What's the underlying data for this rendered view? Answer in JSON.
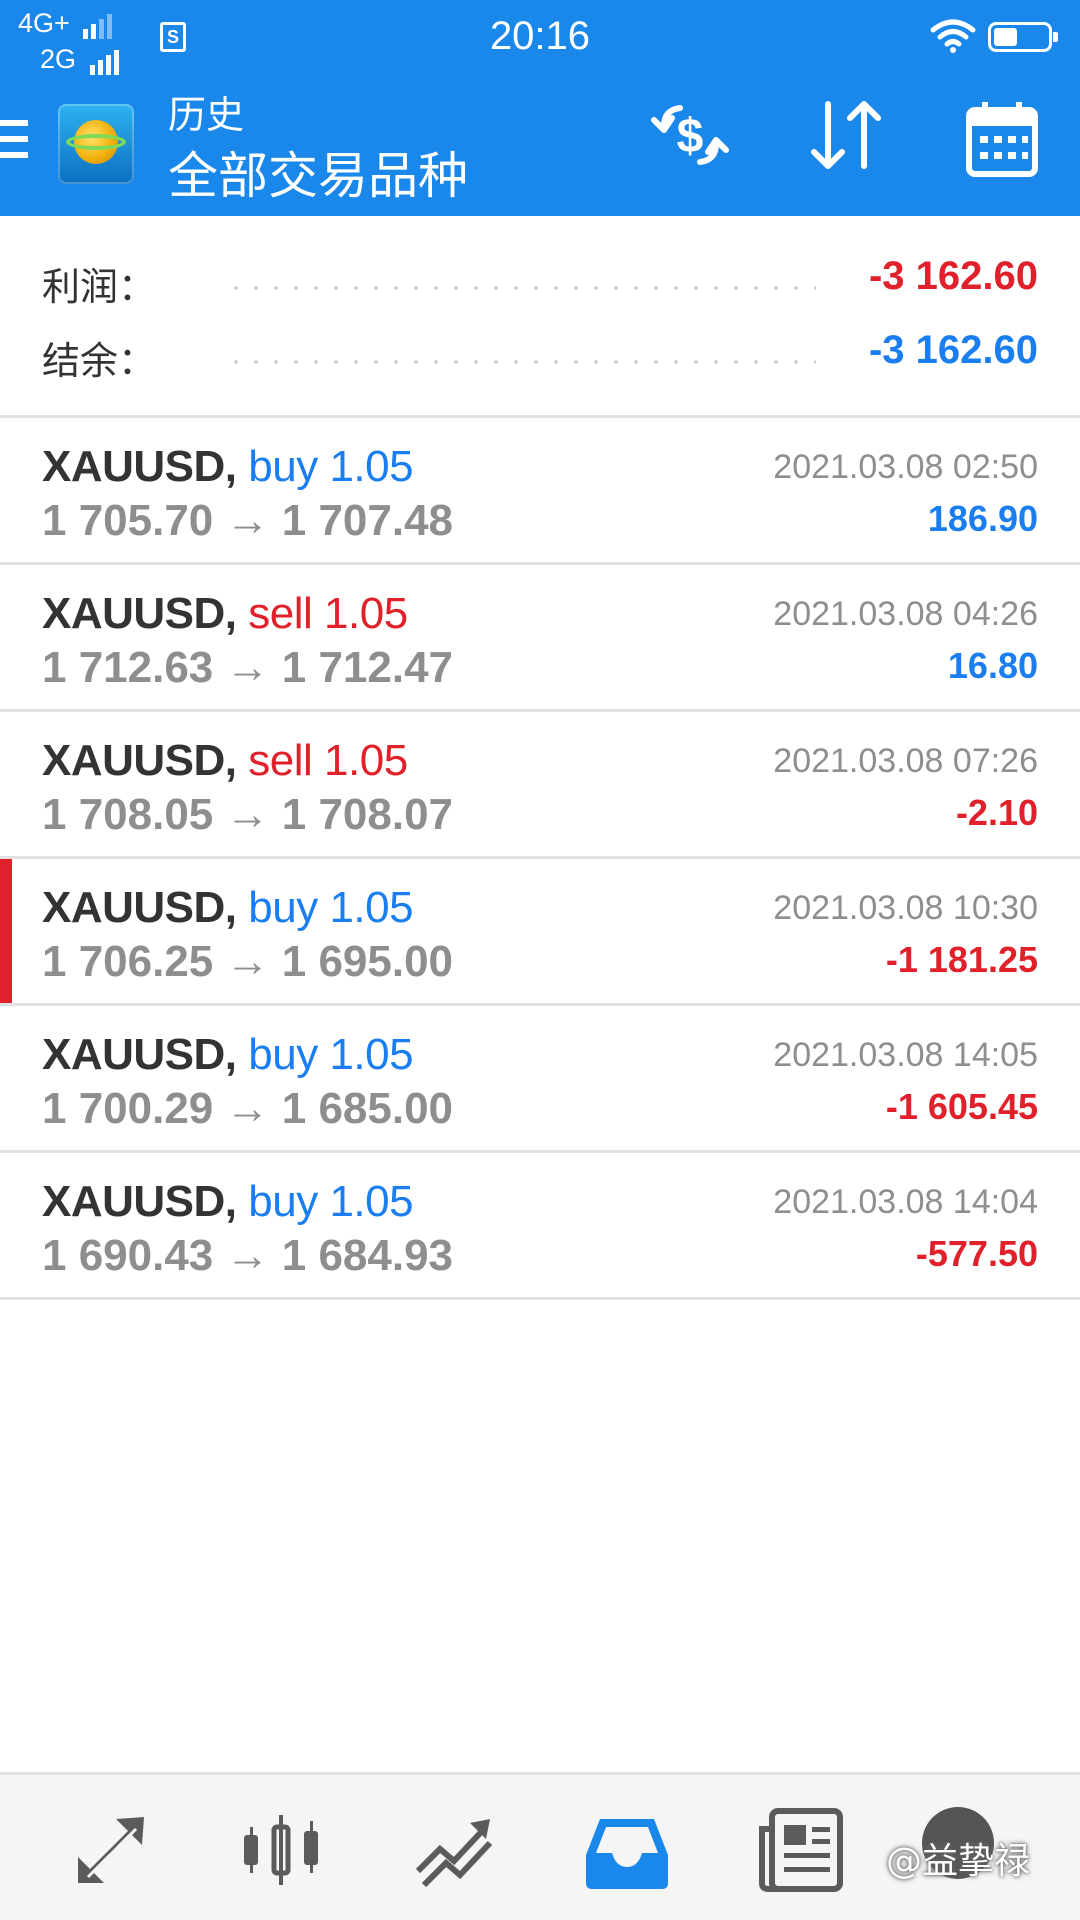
{
  "status_bar": {
    "network_1": "4G+",
    "network_2": "2G",
    "sim_label": "S",
    "time": "20:16",
    "battery_level": 0.45
  },
  "header": {
    "title_small": "历史",
    "title_large": "全部交易品种",
    "icons": [
      "menu-icon",
      "app-logo",
      "money-exchange-icon",
      "sort-icon",
      "calendar-icon"
    ]
  },
  "summary": {
    "profit_label": "利润：",
    "profit_value": "-3 162.60",
    "balance_label": "结余：",
    "balance_value": "-3 162.60"
  },
  "trades": [
    {
      "symbol": "XAUUSD,",
      "side": "buy",
      "volume": "1.05",
      "open": "1 705.70",
      "close": "1 707.48",
      "time": "2021.03.08 02:50",
      "profit": "186.90",
      "profit_color": "blue",
      "marked": false
    },
    {
      "symbol": "XAUUSD,",
      "side": "sell",
      "volume": "1.05",
      "open": "1 712.63",
      "close": "1 712.47",
      "time": "2021.03.08 04:26",
      "profit": "16.80",
      "profit_color": "blue",
      "marked": false
    },
    {
      "symbol": "XAUUSD,",
      "side": "sell",
      "volume": "1.05",
      "open": "1 708.05",
      "close": "1 708.07",
      "time": "2021.03.08 07:26",
      "profit": "-2.10",
      "profit_color": "red",
      "marked": false
    },
    {
      "symbol": "XAUUSD,",
      "side": "buy",
      "volume": "1.05",
      "open": "1 706.25",
      "close": "1 695.00",
      "time": "2021.03.08 10:30",
      "profit": "-1 181.25",
      "profit_color": "red",
      "marked": true
    },
    {
      "symbol": "XAUUSD,",
      "side": "buy",
      "volume": "1.05",
      "open": "1 700.29",
      "close": "1 685.00",
      "time": "2021.03.08 14:05",
      "profit": "-1 605.45",
      "profit_color": "red",
      "marked": false
    },
    {
      "symbol": "XAUUSD,",
      "side": "buy",
      "volume": "1.05",
      "open": "1 690.43",
      "close": "1 684.93",
      "time": "2021.03.08 14:04",
      "profit": "-577.50",
      "profit_color": "red",
      "marked": false
    }
  ],
  "arrow": "→",
  "bottom_nav": {
    "items": [
      "quotes-icon",
      "chart-candles-icon",
      "trade-icon",
      "history-inbox-icon",
      "news-icon",
      "chat-icon"
    ],
    "active": "history-inbox-icon",
    "colors": {
      "active": "#1a88ea",
      "inactive": "#5b5b5b"
    }
  },
  "watermark": "@益挚禄",
  "colors": {
    "accent": "#1a88ea",
    "positive": "#1a7ef0",
    "negative": "#e0202a"
  }
}
